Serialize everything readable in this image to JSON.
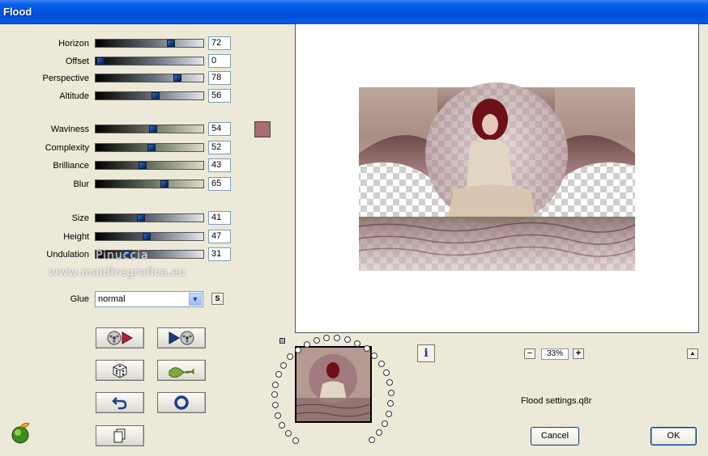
{
  "window": {
    "title": "Flood"
  },
  "params": {
    "horizon": {
      "label": "Horizon",
      "value": "72"
    },
    "offset": {
      "label": "Offset",
      "value": "0"
    },
    "perspective": {
      "label": "Perspective",
      "value": "78"
    },
    "altitude": {
      "label": "Altitude",
      "value": "56"
    },
    "waviness": {
      "label": "Waviness",
      "value": "54"
    },
    "complexity": {
      "label": "Complexity",
      "value": "52"
    },
    "brilliance": {
      "label": "Brilliance",
      "value": "43"
    },
    "blur": {
      "label": "Blur",
      "value": "65"
    },
    "size": {
      "label": "Size",
      "value": "41"
    },
    "height": {
      "label": "Height",
      "value": "47"
    },
    "undulation": {
      "label": "Undulation",
      "value": "31"
    }
  },
  "color_swatch": "#a86e72",
  "glue": {
    "label": "Glue",
    "value": "normal",
    "side_button": "S"
  },
  "watermark": {
    "line1": "Pinuccia",
    "line2": "www.maldiregrafica.eu"
  },
  "zoom": {
    "value": "33%",
    "minus": "−",
    "plus": "+"
  },
  "scroll_up": "▲",
  "info": "i",
  "settings_file": "Flood settings.q8r",
  "buttons": {
    "cancel": "Cancel",
    "ok": "OK"
  },
  "icons": {
    "logo": "globe-leaf-icon",
    "load_preset": "film-reel-arrow-icon",
    "save_preset": "arrow-film-reel-icon",
    "randomize": "dice-icon",
    "wave": "wave-icon",
    "undo": "undo-icon",
    "reset": "ring-icon",
    "copy": "copy-page-icon"
  }
}
